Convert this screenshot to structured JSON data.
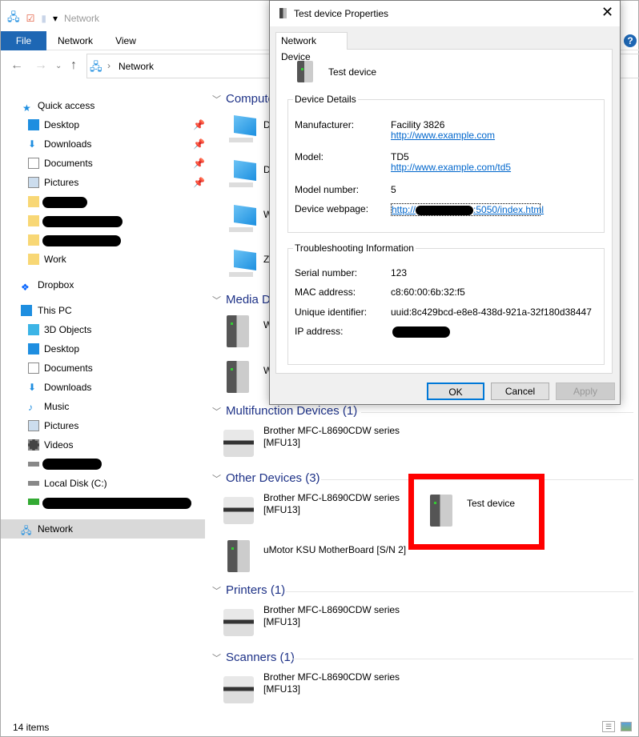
{
  "explorer": {
    "title": "Network",
    "ribbon_tabs": [
      "File",
      "Network",
      "View"
    ],
    "address": "Network",
    "status": "14 items",
    "sidebar": {
      "quick_access": "Quick access",
      "qa_items": [
        "Desktop",
        "Downloads",
        "Documents",
        "Pictures"
      ],
      "work": "Work",
      "dropbox": "Dropbox",
      "this_pc": "This PC",
      "pc_items": [
        "3D Objects",
        "Desktop",
        "Documents",
        "Downloads",
        "Music",
        "Pictures",
        "Videos"
      ],
      "local_disk": "Local Disk (C:)",
      "network": "Network"
    },
    "groups": {
      "computer": {
        "header": "Compute",
        "items": [
          "D",
          "D",
          "W",
          "ZV"
        ]
      },
      "media": {
        "header": "Media De",
        "items": [
          "W",
          "W"
        ]
      },
      "multifunction": {
        "header": "Multifunction Devices (1)",
        "items": [
          [
            "Brother MFC-L8690CDW series",
            "[MFU13]"
          ]
        ]
      },
      "other": {
        "header": "Other Devices (3)",
        "items": [
          [
            "Brother MFC-L8690CDW series",
            "[MFU13]"
          ],
          [
            "uMotor KSU MotherBoard [S/N 2]"
          ],
          [
            "Test device"
          ]
        ]
      },
      "printers": {
        "header": "Printers (1)",
        "items": [
          [
            "Brother MFC-L8690CDW series",
            "[MFU13]"
          ]
        ]
      },
      "scanners": {
        "header": "Scanners (1)",
        "items": [
          [
            "Brother MFC-L8690CDW series",
            "[MFU13]"
          ]
        ]
      }
    },
    "highlight_color": "#ff0000"
  },
  "dialog": {
    "title": "Test device Properties",
    "tab": "Network Device",
    "device_name": "Test device",
    "details": {
      "title": "Device Details",
      "manufacturer_label": "Manufacturer:",
      "manufacturer": "Facility 3826",
      "manufacturer_url": "http://www.example.com",
      "model_label": "Model:",
      "model": "TD5",
      "model_url": "http://www.example.com/td5",
      "model_number_label": "Model number:",
      "model_number": "5",
      "webpage_label": "Device webpage:",
      "webpage_prefix": "http://",
      "webpage_suffix": ":5050/index.html"
    },
    "troubleshooting": {
      "title": "Troubleshooting Information",
      "serial_label": "Serial number:",
      "serial": "123",
      "mac_label": "MAC address:",
      "mac": "c8:60:00:6b:32:f5",
      "uid_label": "Unique identifier:",
      "uid": "uuid:8c429bcd-e8e8-438d-921a-32f180d38447",
      "ip_label": "IP address:"
    },
    "buttons": {
      "ok": "OK",
      "cancel": "Cancel",
      "apply": "Apply"
    }
  }
}
